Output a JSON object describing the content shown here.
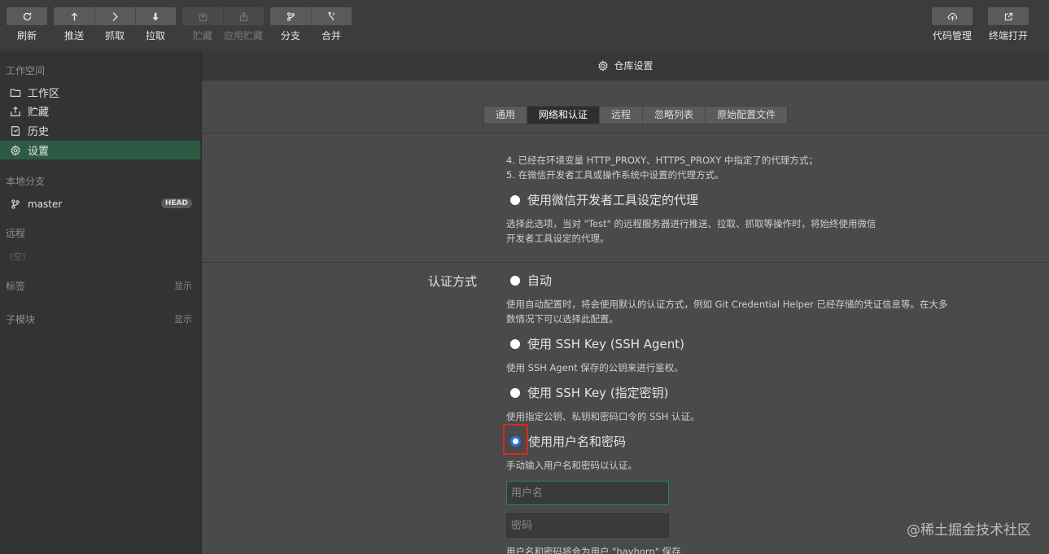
{
  "toolbar": {
    "refresh": "刷新",
    "push": "推送",
    "fetch": "抓取",
    "pull": "拉取",
    "stash": "贮藏",
    "apply_stash": "应用贮藏",
    "branch": "分支",
    "merge": "合并",
    "code_manage": "代码管理",
    "open_terminal": "终端打开"
  },
  "sidebar": {
    "workspace_title": "工作空间",
    "items": [
      {
        "label": "工作区",
        "icon": "folder-icon"
      },
      {
        "label": "贮藏",
        "icon": "stash-icon"
      },
      {
        "label": "历史",
        "icon": "history-icon"
      },
      {
        "label": "设置",
        "icon": "gear-icon"
      }
    ],
    "local_branches_title": "本地分支",
    "branch_name": "master",
    "head_badge": "HEAD",
    "remote_title": "远程",
    "remote_empty": "(空)",
    "tags_title": "标签",
    "tags_show": "显示",
    "submodules_title": "子模块",
    "submodules_show": "显示"
  },
  "main": {
    "title": "仓库设置",
    "tabs": [
      "通用",
      "网络和认证",
      "远程",
      "忽略列表",
      "原始配置文件"
    ],
    "active_tab": "网络和认证",
    "proxy_note_4": "4. 已经在环境变量 HTTP_PROXY、HTTPS_PROXY 中指定了的代理方式；",
    "proxy_note_5": "5. 在微信开发者工具或操作系统中设置的代理方式。",
    "devtools_proxy_label": "使用微信开发者工具设定的代理",
    "devtools_proxy_desc_1": "选择此选项，当对 \"Test\" 的远程服务器进行推送、拉取、抓取等操作时，将始终使用微信",
    "devtools_proxy_desc_2": "开发者工具设定的代理。",
    "auth_label": "认证方式",
    "auth_options": [
      {
        "label": "自动",
        "desc": "使用自动配置时，将会使用默认的认证方式，例如 Git Credential Helper 已经存储的凭证信息等。在大多"
      },
      {
        "label": "使用 SSH Key (SSH Agent)",
        "desc": "使用 SSH Agent 保存的公钥来进行鉴权。"
      },
      {
        "label": "使用 SSH Key (指定密钥)",
        "desc": "使用指定公钥、私钥和密码口令的 SSH 认证。"
      },
      {
        "label": "使用用户名和密码",
        "desc": "手动输入用户名和密码以认证。"
      }
    ],
    "auto_desc_2": "数情况下可以选择此配置。",
    "selected_auth": "使用用户名和密码",
    "username_placeholder": "用户名",
    "password_placeholder": "密码",
    "save_note": "用户名和密码将会为用户 \"hayhorn\" 保存"
  },
  "watermark": "@稀土掘金技术社区",
  "colors": {
    "accent": "#2d5a43",
    "radio_checked": "#2f73e0",
    "highlight": "#e0261f"
  }
}
